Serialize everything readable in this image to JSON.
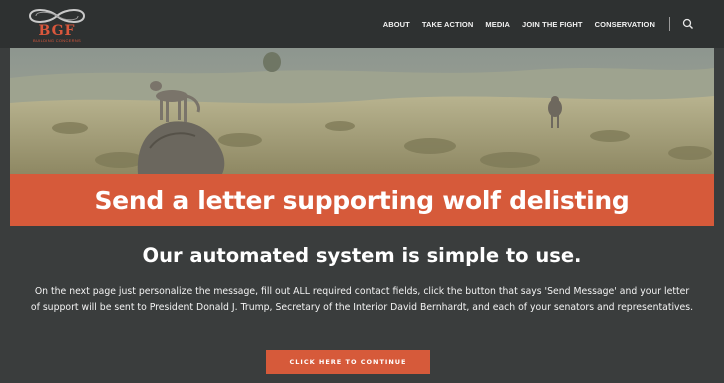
{
  "header": {
    "logo_text": "BGF",
    "logo_subtext": "BUILDING CONCERNS",
    "nav": [
      {
        "label": "ABOUT"
      },
      {
        "label": "TAKE ACTION"
      },
      {
        "label": "MEDIA"
      },
      {
        "label": "JOIN THE FIGHT"
      },
      {
        "label": "CONSERVATION"
      }
    ],
    "search_icon": "search-icon"
  },
  "hero": {
    "image": "wolves-on-rocky-hillside"
  },
  "banner": {
    "title": "Send a letter supporting wolf delisting"
  },
  "content": {
    "subhead": "Our automated system is simple to use.",
    "description": "On the next page just personalize the message, fill out ALL required contact fields, click the button that says 'Send Message' and your letter of support will be sent to President Donald J. Trump, Secretary of the Interior David Bernhardt, and each of your senators and representatives.",
    "cta_label": "CLICK HERE TO CONTINUE"
  },
  "colors": {
    "header_bg": "#2e3131",
    "accent": "#d65a3a",
    "body_bg": "#3a3d3d"
  }
}
